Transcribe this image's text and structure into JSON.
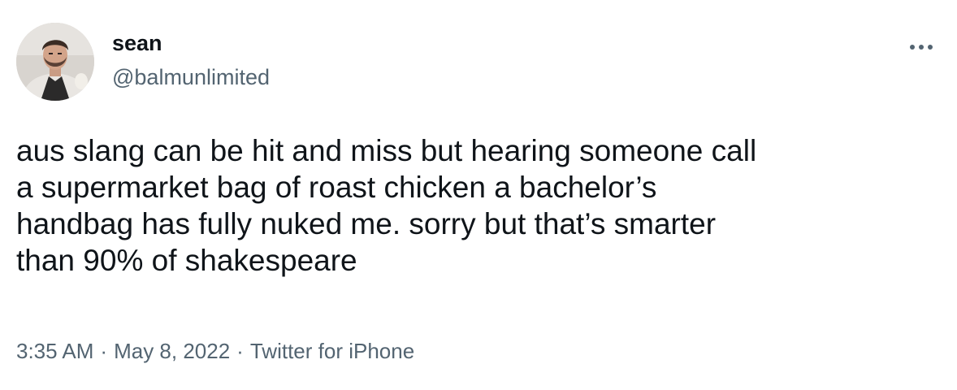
{
  "tweet": {
    "author": {
      "display_name": "sean",
      "handle": "@balmunlimited",
      "avatar_icon": "profile-photo"
    },
    "more_icon": "more-horizontal-icon",
    "text": "aus slang can be hit and miss but hearing someone call\na supermarket bag of roast chicken a bachelor’s\nhandbag has fully nuked me. sorry but that’s smarter\nthan 90% of shakespeare",
    "meta": {
      "time": "3:35 AM",
      "separator": "·",
      "date": "May 8, 2022",
      "source": "Twitter for iPhone"
    }
  },
  "colors": {
    "text_primary": "#0f1419",
    "text_secondary": "#536471",
    "background": "#ffffff"
  }
}
